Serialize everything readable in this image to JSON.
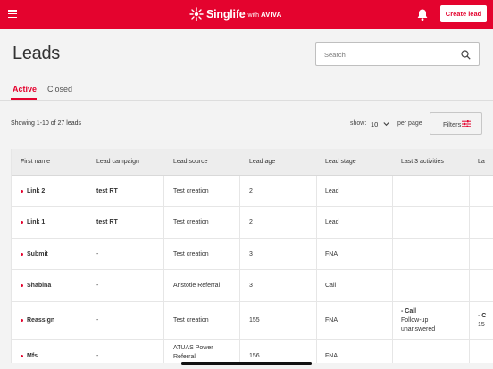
{
  "header": {
    "brand_name": "Singlife",
    "brand_with": "with",
    "brand_partner": "AVIVA",
    "create_lead_label": "Create lead",
    "accent_color": "#e4032e"
  },
  "page": {
    "title": "Leads"
  },
  "search": {
    "placeholder": "Search",
    "value": ""
  },
  "tabs": [
    {
      "label": "Active",
      "active": true
    },
    {
      "label": "Closed",
      "active": false
    }
  ],
  "toolbar": {
    "showing_text": "Showing 1-10 of 27 leads",
    "show_label": "show:",
    "page_size": "10",
    "per_page_label": "per page",
    "filters_label": "Filters"
  },
  "table": {
    "headers": [
      "First name",
      "Lead campaign",
      "Lead source",
      "Lead age",
      "Lead stage",
      "Last 3 activities",
      "La"
    ],
    "rows": [
      {
        "name": "Link 2",
        "campaign": "test RT",
        "source": "Test creation",
        "age": "2",
        "stage": "Lead",
        "activity": [],
        "extra": ""
      },
      {
        "name": "Link 1",
        "campaign": "test RT",
        "source": "Test creation",
        "age": "2",
        "stage": "Lead",
        "activity": [],
        "extra": ""
      },
      {
        "name": "Submit",
        "campaign": "-",
        "source": "Test creation",
        "age": "3",
        "stage": "FNA",
        "activity": [],
        "extra": ""
      },
      {
        "name": "Shabina",
        "campaign": "-",
        "source": "Aristotle Referral",
        "age": "3",
        "stage": "Call",
        "activity": [],
        "extra": ""
      },
      {
        "name": "Reassign",
        "campaign": "-",
        "source": "Test creation",
        "age": "155",
        "stage": "FNA",
        "activity": [
          "- Call",
          "Follow-up",
          "unanswered"
        ],
        "extra": [
          "- C",
          "15"
        ]
      },
      {
        "name": "Mfs",
        "campaign": "-",
        "source": [
          "ATUAS Power",
          "Referral"
        ],
        "age": "156",
        "stage": "FNA",
        "activity": [],
        "extra": ""
      }
    ]
  }
}
